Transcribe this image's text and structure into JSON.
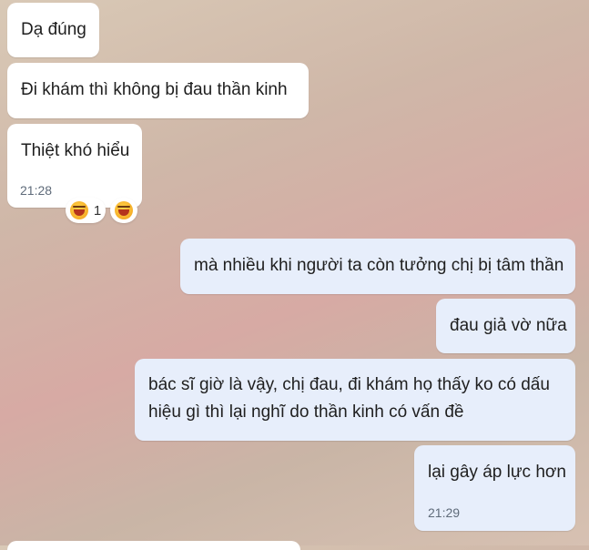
{
  "messages": {
    "incoming": [
      {
        "text": "Dạ đúng"
      },
      {
        "text": "Đi khám thì không bị đau thần kinh"
      },
      {
        "text": "Thiệt khó hiểu",
        "time": "21:28"
      }
    ],
    "reactions": [
      {
        "icon": "laughing-crying-emoji",
        "count": "1"
      },
      {
        "icon": "laughing-crying-emoji",
        "count": ""
      }
    ],
    "outgoing": [
      {
        "text": "mà nhiều khi người ta còn tưởng chị bị tâm thần"
      },
      {
        "text": "đau giả vờ nữa"
      },
      {
        "line1": "bác sĩ giờ là vậy, chị đau, đi khám họ thấy ko có dấu",
        "line2": "hiệu gì thì lại nghĩ do thần kinh có vấn đề"
      },
      {
        "text": "lại gây áp lực hơn",
        "time": "21:29"
      }
    ]
  },
  "colors": {
    "incoming_bubble": "#ffffff",
    "outgoing_bubble": "#e7eefb"
  }
}
